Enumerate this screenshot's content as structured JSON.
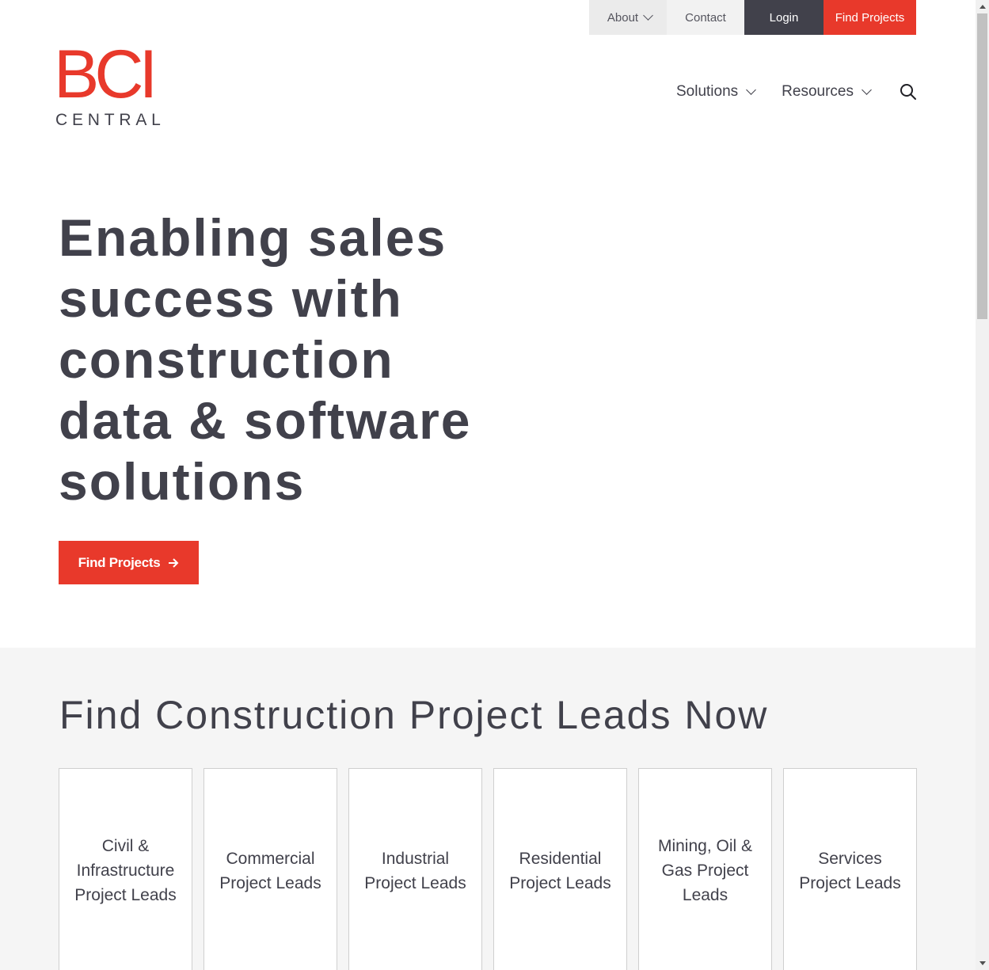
{
  "utility_nav": {
    "about": "About",
    "contact": "Contact",
    "login": "Login",
    "find_projects": "Find Projects"
  },
  "logo": {
    "mark": "BCI",
    "sub": "CENTRAL"
  },
  "main_nav": {
    "solutions": "Solutions",
    "resources": "Resources"
  },
  "hero": {
    "title_lines": [
      "Enabling sales",
      "success with",
      "construction",
      "data & software",
      "solutions"
    ],
    "cta_label": "Find Projects"
  },
  "leads": {
    "title": "Find Construction Project Leads Now",
    "cards": [
      "Civil & Infrastructure Project Leads",
      "Commercial Project Leads",
      "Industrial Project Leads",
      "Residential Project Leads",
      "Mining, Oil & Gas Project Leads",
      "Services Project Leads"
    ]
  },
  "colors": {
    "brand_red": "#e8392b",
    "dark_slate": "#41414b",
    "section_bg": "#f5f5f5"
  },
  "icons": [
    "chevron-down-icon",
    "search-icon",
    "arrow-right-icon"
  ]
}
